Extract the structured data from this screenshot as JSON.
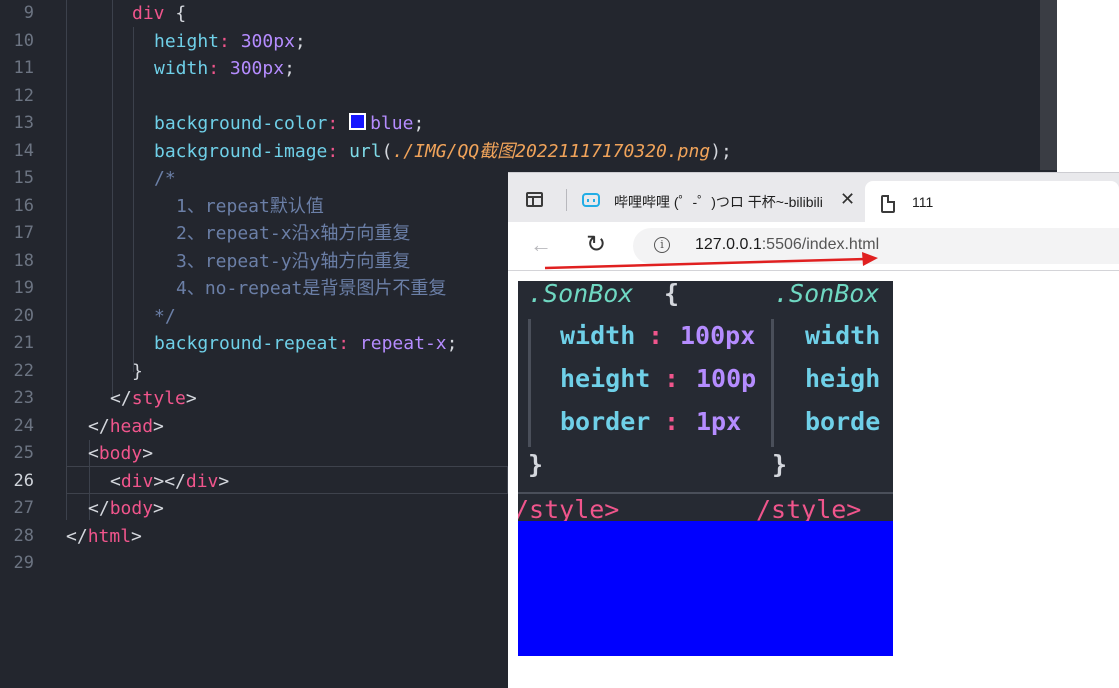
{
  "editor": {
    "line_numbers": [
      "9",
      "10",
      "11",
      "12",
      "13",
      "14",
      "15",
      "16",
      "17",
      "18",
      "19",
      "20",
      "21",
      "22",
      "23",
      "24",
      "25",
      "26",
      "27",
      "28",
      "29"
    ],
    "active_line": "26",
    "lines": {
      "l9_sel": "div",
      "l9_brace": " {",
      "l10_prop": "height",
      "l10_val": "300px",
      "l11_prop": "width",
      "l11_val": "300px",
      "l13_prop": "background-color",
      "l13_val": "blue",
      "l14_prop": "background-image",
      "l14_fn": "url",
      "l14_path": "./IMG/QQ截图20221117170320.png",
      "l15": "/*",
      "l16": "1、repeat默认值",
      "l17": "2、repeat-x沿x轴方向重复",
      "l18": "3、repeat-y沿y轴方向重复",
      "l19": "4、no-repeat是背景图片不重复",
      "l20": "*/",
      "l21_prop": "background-repeat",
      "l21_val": "repeat-x",
      "l22": "}",
      "l23_tag": "style",
      "l24_tag": "head",
      "l25_tag": "body",
      "l26_tag": "div",
      "l27_tag": "body",
      "l28_tag": "html"
    },
    "swatch_color": "#0000ff"
  },
  "browser": {
    "tab1_label": "哔哩哔哩 (゜-゜)つロ 干杯~-bilibili",
    "tab1_close": "✕",
    "tab2_label": "111",
    "address_host": "127.0.0.1",
    "address_rest": ":5506/index.html",
    "info_glyph": "i",
    "back_glyph": "←",
    "reload_glyph": "↻"
  },
  "bg_image": {
    "sel": ".SonBox",
    "brace_open": "{",
    "p1": "width",
    "v1": "100px",
    "p2": "height",
    "v2": "100p",
    "p3": "border",
    "v3": "1px",
    "brace_close": "}",
    "style_tag": "/style>",
    "sel2": ".SonBox",
    "p1b": "width",
    "p2b": "heigh",
    "p3b": "borde",
    "brace_close2": "}",
    "style_tag2": "/style>"
  },
  "colors": {
    "accent_red": "#e02020",
    "bg_blue": "#0000ff"
  }
}
